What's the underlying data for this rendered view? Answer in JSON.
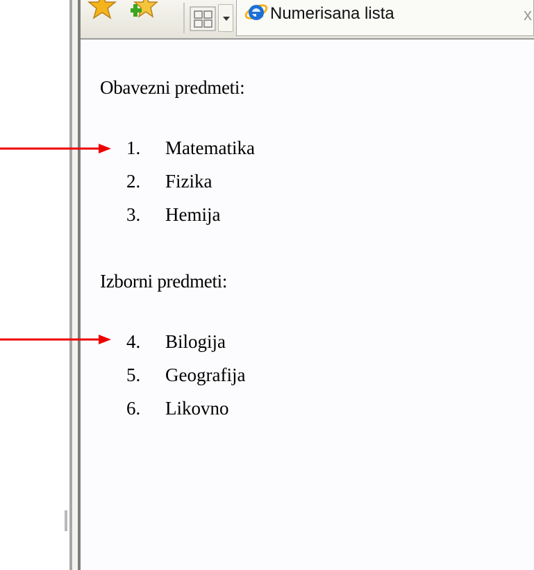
{
  "browser": {
    "tab": {
      "title": "Numerisana lista",
      "close_glyph": "x",
      "icon": "ie-logo-icon"
    },
    "toolbar": {
      "icons": [
        "favorites-star-icon",
        "add-favorite-icon",
        "quick-tabs-icon",
        "tab-list-dropdown-icon"
      ]
    },
    "colors": {
      "arrow": "#ee0000",
      "ie_blue": "#1c6fd6",
      "star": "#f5b41b",
      "plus": "#3aa51d"
    }
  },
  "page": {
    "sections": [
      {
        "heading": "Obavezni predmeti:",
        "items": [
          {
            "number": "1.",
            "label": "Matematika"
          },
          {
            "number": "2.",
            "label": "Fizika"
          },
          {
            "number": "3.",
            "label": "Hemija"
          }
        ]
      },
      {
        "heading": "Izborni predmeti:",
        "items": [
          {
            "number": "4.",
            "label": "Bilogija"
          },
          {
            "number": "5.",
            "label": "Geografija"
          },
          {
            "number": "6.",
            "label": "Likovno"
          }
        ]
      }
    ]
  },
  "annotations": [
    "red-arrow-icon",
    "red-arrow-icon"
  ]
}
